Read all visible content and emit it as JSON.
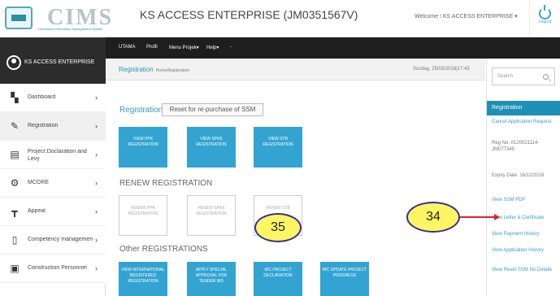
{
  "header": {
    "logo_text": "CIMS",
    "logo_sub": "Centralized Information Management System",
    "title": "KS ACCESS ENTERPRISE (JM0351567V)",
    "welcome": "Welcome ! KS ACCESS ENTERPRISE ▾",
    "logout": "Logout"
  },
  "topnav": [
    "UTAMA",
    "Profil",
    "Menu Projek▾",
    "Help▾",
    "-"
  ],
  "sidebar": {
    "profile_name": "KS ACCESS ENTERPRISE",
    "items": [
      {
        "label": "Dashboard",
        "icon": "dashboard-icon"
      },
      {
        "label": "Registration",
        "icon": "edit-icon"
      },
      {
        "label": "Project Doclaration and Levy",
        "icon": "print-icon"
      },
      {
        "label": "MCORE",
        "icon": "gear-icon"
      },
      {
        "label": "Appeal",
        "icon": "sitemap-icon"
      },
      {
        "label": "Competency managemen",
        "icon": "document-icon"
      },
      {
        "label": "Construction Personnel",
        "icon": "id-card-icon"
      }
    ]
  },
  "main": {
    "breadcrumb": "Registration",
    "breadcrumb_path": "Home/Registration",
    "datetime": "Sunday, 25/03/2018|17:43",
    "registration_label": "Registration",
    "reset_button": "Reset for re-purchase of SSM",
    "tiles": [
      "VIEW PPK REGISTRATION",
      "VIEW SPKK REGISTRATION",
      "VIEW STB REGISTRATION"
    ],
    "renew_label": "RENEW REGISTRATION",
    "renew_tiles": [
      "RENEW PPK REGISTRATION",
      "RENEW SPKK REGISTRATION",
      "RENEW STB"
    ],
    "other_label": "Other REGISTRATIONS",
    "other_tiles": [
      "VIEW INTERNATIONAL REGISTERED REGISTRATION",
      "APPLY SPECIAL APPROVAL FOR TENDER BID",
      "IRC PROJECT DECLARATION",
      "IRC UPDATE PROJECT PROGRESS"
    ]
  },
  "right": {
    "search_placeholder": "Search",
    "panel_title": "Registration",
    "cancel": "Cancel Application Request",
    "reg_no": "Reg No. 0120021114-JM077345",
    "expiry": "Expiry Date: 16/12/2018",
    "view_ssm": "View SSM PDF",
    "view_letter": "View Letter & Certificate",
    "view_payment": "View Payment History",
    "view_app": "View Application History",
    "view_reset": "View Reset SSM No Details"
  },
  "annotations": {
    "a35": "35",
    "a34": "34"
  },
  "colors": {
    "accent": "#33a4d2",
    "topnav": "#1e1e1e",
    "annotation": "#fdf562"
  }
}
